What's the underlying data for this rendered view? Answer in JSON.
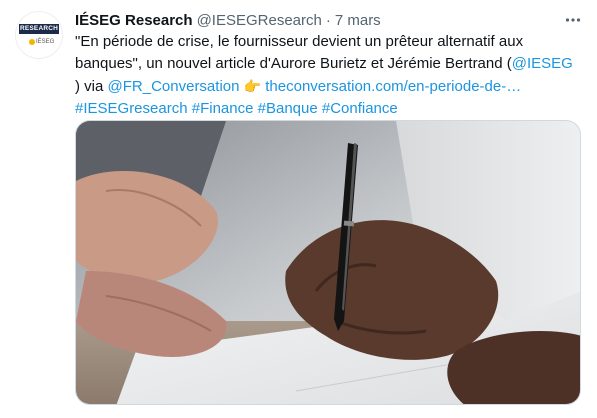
{
  "tweet": {
    "author": {
      "name": "IÉSEG Research",
      "handle": "@IESEGResearch",
      "separator": "·",
      "date": "7 mars",
      "avatar_banner": "RESEARCH",
      "avatar_logo": "IÉSEG"
    },
    "more_icon": "more-icon",
    "text": {
      "line1": "\"En période de crise, le fournisseur devient un prêteur alternatif aux",
      "line2_text": "banques\", un nouvel article d'Aurore Burietz et Jérémie Bertrand (",
      "line2_mention": "@IESEG",
      "line3_text": ") via ",
      "line3_mention": "@FR_Conversation",
      "line3_emoji": "👉",
      "line3_link": "theconversation.com/en-periode-de-…",
      "hashtags": [
        "#IESEGresearch",
        "#Finance",
        "#Banque",
        "#Confiance"
      ]
    },
    "media": {
      "icon": "photo"
    },
    "colors": {
      "link": "#1b95e0",
      "secondary": "#536471",
      "primary": "#0f1419"
    }
  }
}
